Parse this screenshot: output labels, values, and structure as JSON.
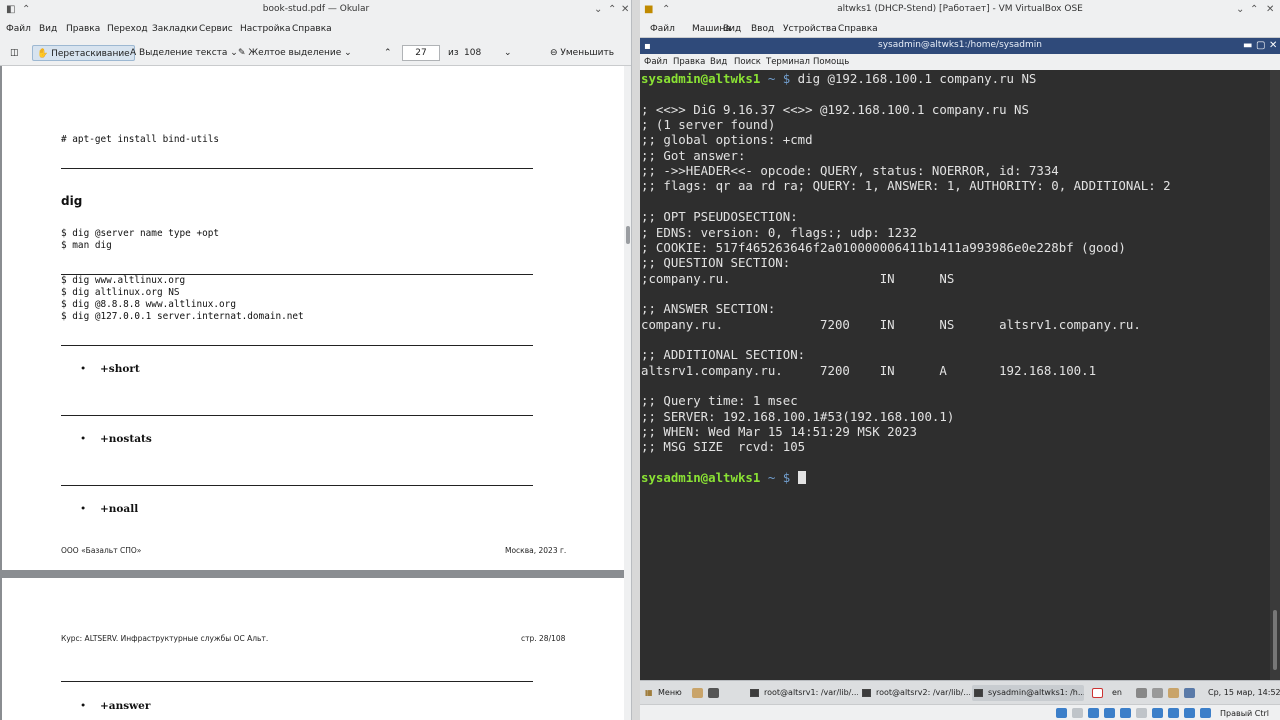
{
  "okular": {
    "window_title": "book-stud.pdf — Okular",
    "menu": [
      "Файл",
      "Вид",
      "Правка",
      "Переход",
      "Закладки",
      "Сервис",
      "Настройка",
      "Справка"
    ],
    "toolbar": {
      "drag_label": "Перетаскивание",
      "select_text_label": "Выделение текста",
      "highlight_label": "Желтое выделение",
      "page_current": "27",
      "page_of_label": "из",
      "page_total": "108",
      "zoom_out_label": "Уменьшить"
    },
    "page1": {
      "top_code": "# apt-get install bind-utils",
      "heading": "dig",
      "syntax_lines": [
        "$ dig @server name type +opt",
        "$ man dig"
      ],
      "examples": [
        "$ dig www.altlinux.org",
        "$ dig altlinux.org NS",
        "$ dig @8.8.8.8 www.altlinux.org",
        "$ dig @127.0.0.1 server.internat.domain.net"
      ],
      "bullets": [
        "+short",
        "+nostats",
        "+noall"
      ],
      "footer_left": "ООО «Базальт СПО»",
      "footer_right": "Москва, 2023 г."
    },
    "page2": {
      "header_left": "Курс: ALTSERV. Инфраструктурные службы ОС Альт.",
      "header_right": "стр. 28/108",
      "bullets": [
        "+answer"
      ]
    }
  },
  "vbox": {
    "window_title": "altwks1 (DHCP-Stend) [Работает] - VM VirtualBox OSE",
    "menu": [
      "Файл",
      "Машина",
      "Вид",
      "Ввод",
      "Устройства",
      "Справка"
    ],
    "terminal_title": "sysadmin@altwks1:/home/sysadmin",
    "terminal_menu": [
      "Файл",
      "Правка",
      "Вид",
      "Поиск",
      "Терминал",
      "Помощь"
    ],
    "prompt_user": "sysadmin@altwks1",
    "prompt_path": " ~ ",
    "prompt_symbol": "$ ",
    "command": "dig @192.168.100.1 company.ru NS",
    "output": [
      "",
      "; <<>> DiG 9.16.37 <<>> @192.168.100.1 company.ru NS",
      "; (1 server found)",
      ";; global options: +cmd",
      ";; Got answer:",
      ";; ->>HEADER<<- opcode: QUERY, status: NOERROR, id: 7334",
      ";; flags: qr aa rd ra; QUERY: 1, ANSWER: 1, AUTHORITY: 0, ADDITIONAL: 2",
      "",
      ";; OPT PSEUDOSECTION:",
      "; EDNS: version: 0, flags:; udp: 1232",
      "; COOKIE: 517f465263646f2a010000006411b1411a993986e0e228bf (good)",
      ";; QUESTION SECTION:",
      ";company.ru.                    IN      NS",
      "",
      ";; ANSWER SECTION:",
      "company.ru.             7200    IN      NS      altsrv1.company.ru.",
      "",
      ";; ADDITIONAL SECTION:",
      "altsrv1.company.ru.     7200    IN      A       192.168.100.1",
      "",
      ";; Query time: 1 msec",
      ";; SERVER: 192.168.100.1#53(192.168.100.1)",
      ";; WHEN: Wed Mar 15 14:51:29 MSK 2023",
      ";; MSG SIZE  rcvd: 105",
      ""
    ],
    "taskbar": {
      "menu_label": "Меню",
      "tasks": [
        "root@altsrv1: /var/lib/...",
        "root@altsrv2: /var/lib/...",
        "sysadmin@altwks1: /h..."
      ],
      "lang": "en",
      "clock": "Ср, 15 мар, 14:52"
    },
    "host_key_label": "Правый Ctrl"
  }
}
